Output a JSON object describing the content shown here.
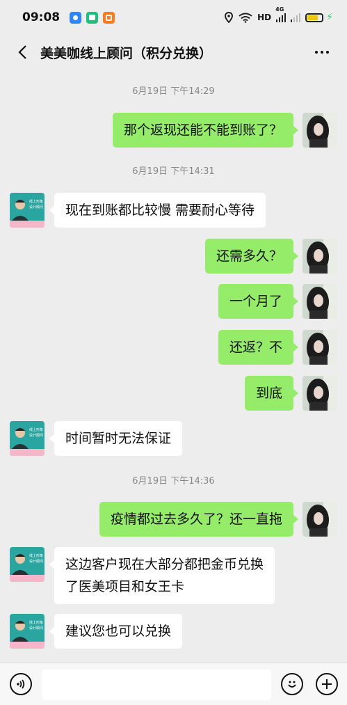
{
  "status_bar": {
    "time": "09:08",
    "network": "HD",
    "signal_label": "4G",
    "battery_level": 0.75,
    "icons": [
      "location-icon",
      "wifi-icon",
      "hd-icon",
      "signal-icon",
      "battery-icon"
    ],
    "app_icons": [
      "browser-app-icon",
      "chat-app-icon",
      "shop-app-icon"
    ]
  },
  "header": {
    "title": "美美咖线上顾问（积分兑换）",
    "back_icon": "chevron-left-icon",
    "more_icon": "more-icon"
  },
  "messages": [
    {
      "type": "timestamp",
      "text": "6月19日 下午14:29"
    },
    {
      "type": "me",
      "text": "那个返现还能不能到账了？"
    },
    {
      "type": "timestamp",
      "text": "6月19日 下午14:31"
    },
    {
      "type": "them",
      "text": "现在到账都比较慢 需要耐心等待"
    },
    {
      "type": "me",
      "text": "还需多久？"
    },
    {
      "type": "me",
      "text": "一个月了"
    },
    {
      "type": "me",
      "text": "还返？不"
    },
    {
      "type": "me",
      "text": "到底"
    },
    {
      "type": "them",
      "text": "时间暂时无法保证"
    },
    {
      "type": "timestamp",
      "text": "6月19日 下午14:36"
    },
    {
      "type": "me",
      "text": "疫情都过去多久了？还一直拖"
    },
    {
      "type": "them",
      "lines": [
        "这边客户现在大部分都把金币兑换",
        "了医美项目和女王卡"
      ]
    },
    {
      "type": "them",
      "text": "建议您也可以兑换"
    }
  ],
  "agent_avatar": {
    "line1": "线上形象",
    "line2": "设计顾问"
  },
  "input_bar": {
    "input_value": "",
    "voice_icon": "voice-icon",
    "emoji_icon": "emoji-icon",
    "plus_icon": "plus-icon"
  },
  "colors": {
    "background": "#ededed",
    "my_bubble": "#95ec69",
    "their_bubble": "#ffffff",
    "battery": "#f1c40f"
  }
}
